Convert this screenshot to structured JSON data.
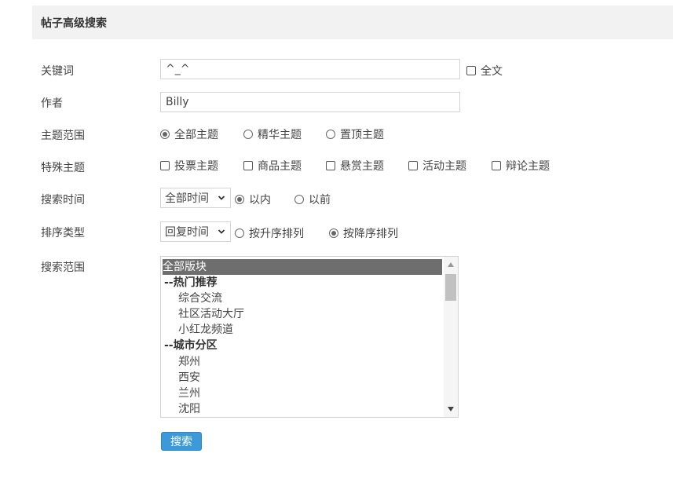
{
  "header": {
    "title": "帖子高级搜索"
  },
  "form": {
    "keyword": {
      "label": "关键词",
      "value": "^_^",
      "fulltext_label": "全文"
    },
    "author": {
      "label": "作者",
      "value": "Billy"
    },
    "topic_range": {
      "label": "主题范围",
      "options": [
        "全部主题",
        "精华主题",
        "置顶主题"
      ],
      "selected": "全部主题"
    },
    "special_topic": {
      "label": "特殊主题",
      "options": [
        "投票主题",
        "商品主题",
        "悬赏主题",
        "活动主题",
        "辩论主题"
      ]
    },
    "search_time": {
      "label": "搜索时间",
      "select_value": "全部时间",
      "options": [
        "以内",
        "以前"
      ],
      "selected": "以内"
    },
    "sort_type": {
      "label": "排序类型",
      "select_value": "回复时间",
      "options": [
        "按升序排列",
        "按降序排列"
      ],
      "selected": "按降序排列"
    },
    "search_scope": {
      "label": "搜索范围",
      "items": [
        {
          "text": "全部版块",
          "kind": "selected"
        },
        {
          "text": "--热门推荐",
          "kind": "group"
        },
        {
          "text": "综合交流",
          "kind": "child"
        },
        {
          "text": "社区活动大厅",
          "kind": "child"
        },
        {
          "text": "小红龙频道",
          "kind": "child"
        },
        {
          "text": "--城市分区",
          "kind": "group"
        },
        {
          "text": "郑州",
          "kind": "child"
        },
        {
          "text": "西安",
          "kind": "child"
        },
        {
          "text": "兰州",
          "kind": "child"
        },
        {
          "text": "沈阳",
          "kind": "child"
        }
      ]
    },
    "submit_label": "搜索"
  },
  "icons": {
    "select_arrow": "chevron-down-icon",
    "scroll_up": "triangle-up-icon",
    "scroll_down": "triangle-down-icon"
  }
}
